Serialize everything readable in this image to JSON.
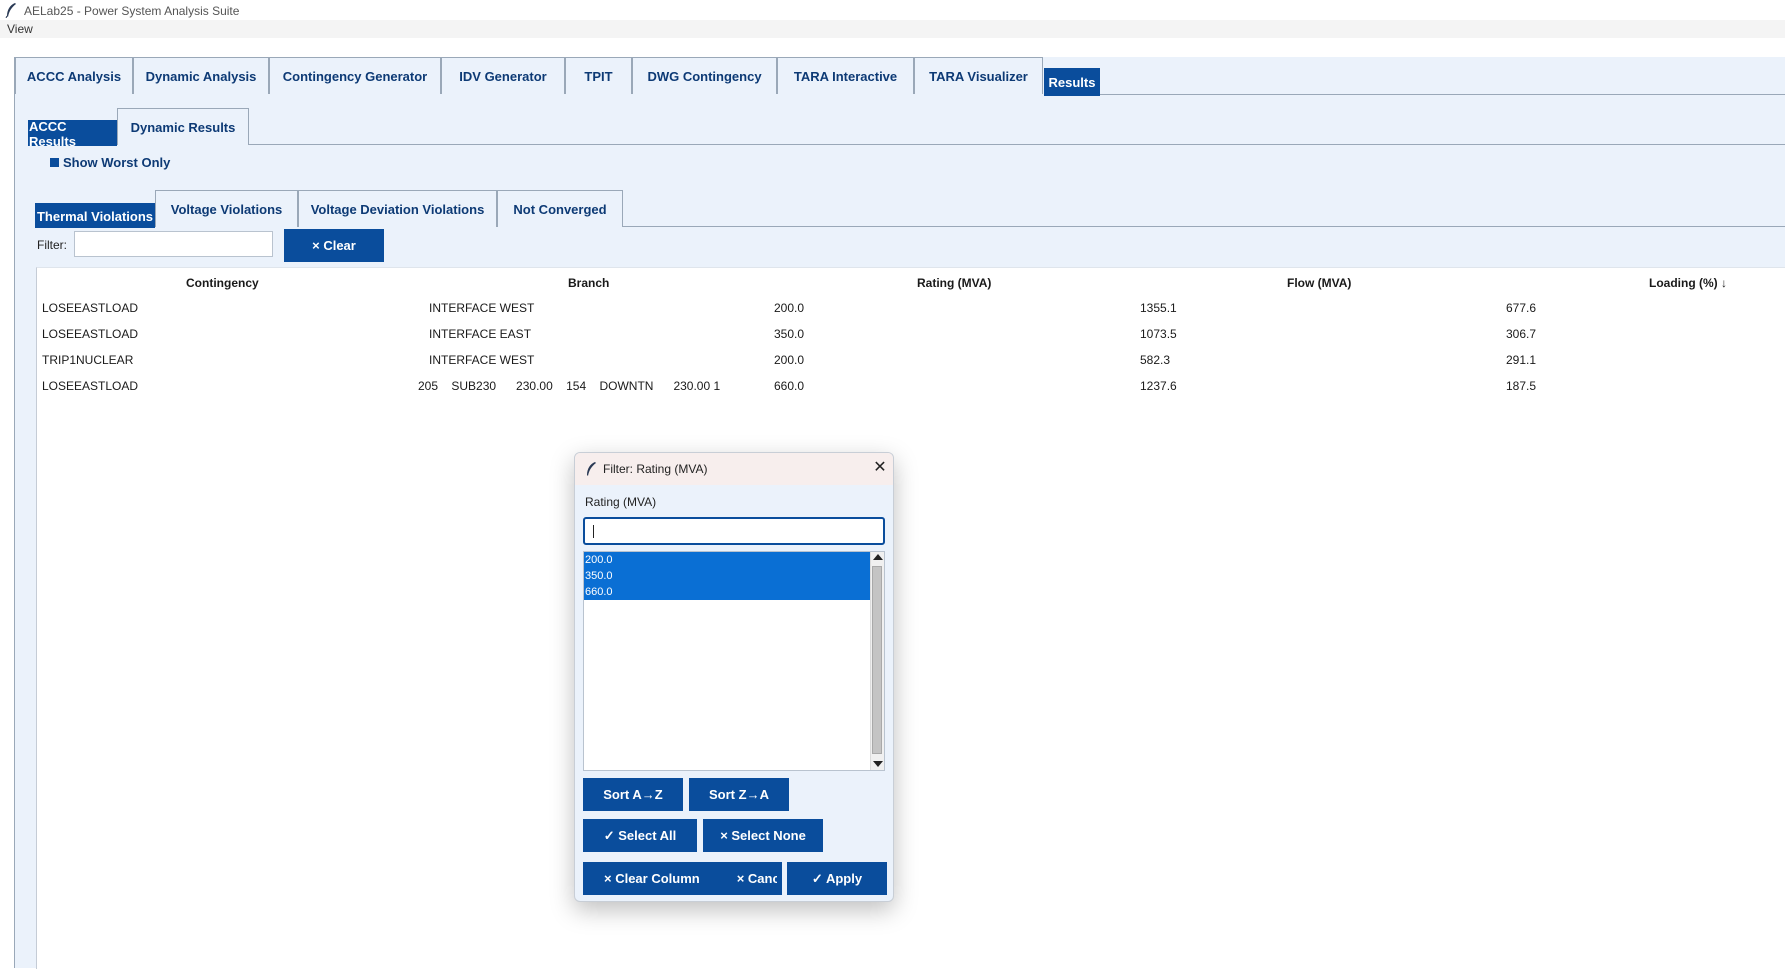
{
  "window": {
    "title": "AELab25 - Power System Analysis Suite"
  },
  "menu": {
    "items": [
      "View"
    ]
  },
  "main_tabs": [
    "ACCC Analysis",
    "Dynamic Analysis",
    "Contingency Generator",
    "IDV Generator",
    "TPIT",
    "DWG Contingency",
    "TARA Interactive",
    "TARA Visualizer",
    "Results"
  ],
  "main_tabs_active": "Results",
  "results_tabs": [
    "ACCC Results",
    "Dynamic Results"
  ],
  "results_tabs_active": "ACCC Results",
  "show_worst": {
    "label": "Show Worst Only"
  },
  "violation_tabs": [
    "Thermal Violations",
    "Voltage Violations",
    "Voltage Deviation Violations",
    "Not Converged"
  ],
  "violation_tabs_active": "Thermal Violations",
  "filter": {
    "label": "Filter:",
    "value": "",
    "clear_label": "× Clear"
  },
  "table": {
    "columns": [
      "Contingency",
      "Branch",
      "Rating (MVA)",
      "Flow (MVA)",
      "Loading (%) ↓"
    ],
    "rows": [
      {
        "contingency": "LOSEEASTLOAD",
        "branch": "INTERFACE WEST",
        "rating": "200.0",
        "flow": "1355.1",
        "loading": "677.6"
      },
      {
        "contingency": "LOSEEASTLOAD",
        "branch": "INTERFACE EAST",
        "rating": "350.0",
        "flow": "1073.5",
        "loading": "306.7"
      },
      {
        "contingency": "TRIP1NUCLEAR",
        "branch": "INTERFACE WEST",
        "rating": "200.0",
        "flow": "582.3",
        "loading": "291.1"
      },
      {
        "contingency": "LOSEEASTLOAD",
        "branch": "205    SUB230      230.00    154    DOWNTN      230.00 1",
        "rating": "660.0",
        "flow": "1237.6",
        "loading": "187.5"
      }
    ]
  },
  "dialog": {
    "title": "Filter: Rating (MVA)",
    "close_label": "✕",
    "column_label": "Rating (MVA)",
    "search_value": "",
    "options": [
      "200.0",
      "350.0",
      "660.0"
    ],
    "buttons": {
      "sort_az": "Sort A→Z",
      "sort_za": "Sort Z→A",
      "select_all": "✓ Select All",
      "select_none": "× Select None",
      "clear_column": "× Clear Column",
      "cancel": "× Cancel",
      "apply": "✓ Apply"
    }
  },
  "colors": {
    "accent": "#0a4d9c",
    "panel": "#ebf2fb",
    "selection": "#0a6fd4"
  }
}
